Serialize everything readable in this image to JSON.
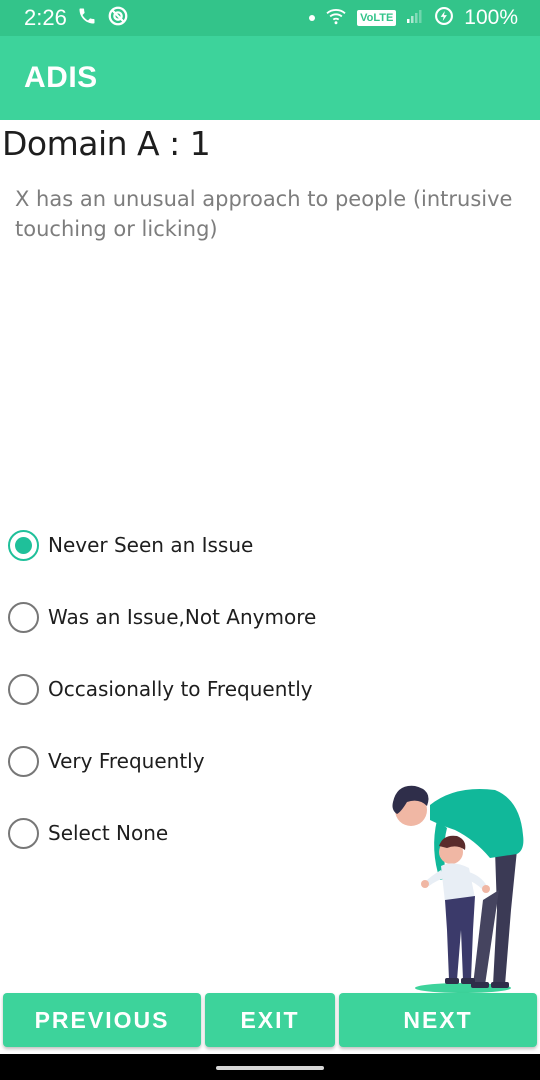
{
  "status_bar": {
    "time": "2:26",
    "network_badge": "VoLTE",
    "battery": "100%",
    "icons": [
      "phone-icon",
      "vpn-icon",
      "dot-icon",
      "wifi-icon",
      "signal-icon",
      "data-saver-icon"
    ]
  },
  "app_bar": {
    "title": "ADIS",
    "color": "#3dd39b"
  },
  "domain_title": "Domain A : 1",
  "question": "X has an unusual approach to people (intrusive touching or licking)",
  "options": [
    {
      "label": "Never Seen an Issue",
      "selected": true
    },
    {
      "label": "Was an Issue,Not Anymore",
      "selected": false
    },
    {
      "label": "Occasionally to Frequently",
      "selected": false
    },
    {
      "label": "Very Frequently",
      "selected": false
    },
    {
      "label": "Select None",
      "selected": false
    }
  ],
  "illustration": "parent-helping-child-walk-illustration",
  "buttons": {
    "previous": "PREVIOUS",
    "exit": "EXIT",
    "next": "NEXT"
  },
  "colors": {
    "accent": "#3dd39b",
    "radio": "#1fc09a",
    "status_bar": "#33c48a"
  }
}
